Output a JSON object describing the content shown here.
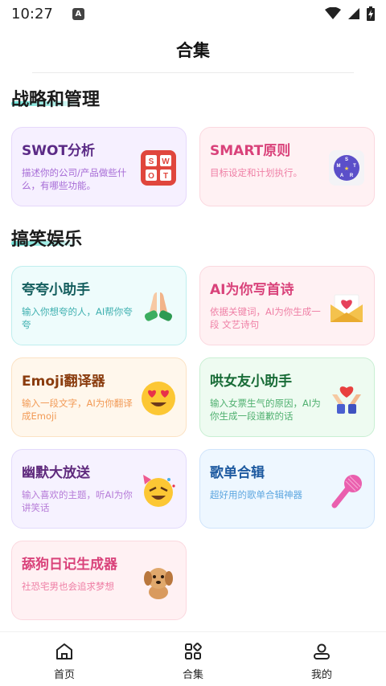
{
  "status_bar": {
    "time": "10:27",
    "notification_icon": "a-icon",
    "wifi_icon": "wifi-icon",
    "signal_icon": "signal-icon",
    "battery_icon": "battery-charging-icon"
  },
  "header": {
    "title": "合集"
  },
  "sections": [
    {
      "title": "战略和管理",
      "cards": [
        {
          "title": "SWOT分析",
          "desc": "描述你的公司/产品做些什么，有哪些功能。",
          "icon": "swot-icon"
        },
        {
          "title": "SMART原则",
          "desc": "目标设定和计划执行。",
          "icon": "smart-circle-icon"
        }
      ]
    },
    {
      "title": "搞笑娱乐",
      "cards": [
        {
          "title": "夸夸小助手",
          "desc": "输入你想夸的人，AI帮你夸夸",
          "icon": "praying-hands-icon"
        },
        {
          "title": "AI为你写首诗",
          "desc": "依据关键词，AI为你生成一段 文艺诗句",
          "icon": "love-letter-icon"
        },
        {
          "title": "Emoji翻译器",
          "desc": "输入一段文字，AI为你翻译成Emoji",
          "icon": "heart-eyes-emoji-icon"
        },
        {
          "title": "哄女友小助手",
          "desc": "输入女票生气的原因，AI为你生成一段道歉的话",
          "icon": "hands-heart-icon"
        },
        {
          "title": "幽默大放送",
          "desc": "输入喜欢的主题，听AI为你讲笑话",
          "icon": "laughing-party-emoji-icon"
        },
        {
          "title": "歌单合辑",
          "desc": "超好用的歌单合辑神器",
          "icon": "microphone-icon"
        },
        {
          "title": "舔狗日记生成器",
          "desc": "社恐宅男也会追求梦想",
          "icon": "puppy-icon"
        }
      ]
    }
  ],
  "bottom_nav": [
    {
      "label": "首页",
      "icon": "home-icon"
    },
    {
      "label": "合集",
      "icon": "grid-icon"
    },
    {
      "label": "我的",
      "icon": "user-icon"
    }
  ]
}
